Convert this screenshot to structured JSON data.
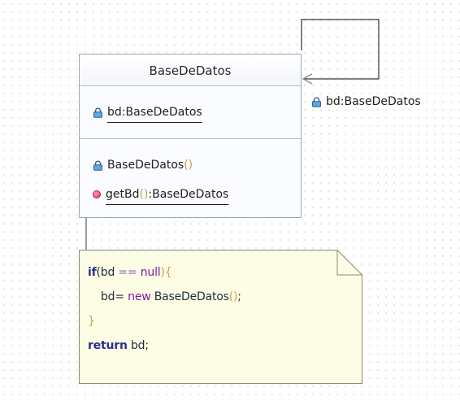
{
  "diagram": {
    "class": {
      "name": "BaseDeDatos",
      "attributes": [
        {
          "label": "bd:BaseDeDatos",
          "visibility": "private",
          "static": true
        }
      ],
      "operations": [
        {
          "name": "BaseDeDatos",
          "params": "()",
          "return": "",
          "visibility": "private",
          "static": false
        },
        {
          "name": "getBd",
          "params": "()",
          "return": ":BaseDeDatos",
          "visibility": "public",
          "static": true
        }
      ]
    },
    "association": {
      "type": "self",
      "role_label": "bd:BaseDeDatos",
      "role_visibility": "private"
    },
    "note": {
      "lines": [
        {
          "kw": "if",
          "rest_a": "(bd ",
          "op": "==",
          "rest_b": " ",
          "kw2": "null",
          "brace": "){"
        },
        {
          "text_a": "bd= ",
          "kw2": "new",
          "text_b": " BaseDeDatos",
          "paren": "()",
          "text_c": ";"
        },
        {
          "brace": "}"
        },
        {
          "kw": "return",
          "text": " bd;"
        }
      ]
    },
    "colors": {
      "class_border": "#9aa6bc",
      "note_fill": "#fdfde6",
      "note_border": "#8b8b6a",
      "public_icon": "#d8315b",
      "private_icon": "#3b84c4"
    }
  }
}
